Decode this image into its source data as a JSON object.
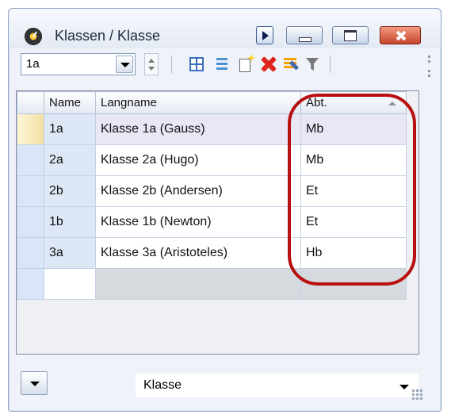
{
  "window": {
    "title": "Klassen / Klasse"
  },
  "toolbar": {
    "combo_value": "1a"
  },
  "grid": {
    "columns": [
      "Name",
      "Langname",
      "Abt."
    ],
    "rows": [
      {
        "name": "1a",
        "langname": "Klasse 1a (Gauss)",
        "abt": "Mb"
      },
      {
        "name": "2a",
        "langname": "Klasse 2a (Hugo)",
        "abt": "Mb"
      },
      {
        "name": "2b",
        "langname": "Klasse 2b (Andersen)",
        "abt": "Et"
      },
      {
        "name": "1b",
        "langname": "Klasse 1b (Newton)",
        "abt": "Et"
      },
      {
        "name": "3a",
        "langname": "Klasse 3a (Aristoteles)",
        "abt": "Hb"
      }
    ],
    "selected_row": "1a",
    "sorted_column": "Abt."
  },
  "bottom": {
    "view_select_value": "Klasse"
  },
  "colors": {
    "highlight": "#b80f10",
    "selection": "#e9e6f6"
  },
  "icons": [
    "app-clock-icon",
    "play-icon",
    "minimize-icon",
    "maximize-icon",
    "close-icon",
    "grid-detail-icon",
    "list-icon",
    "new-record-icon",
    "delete-icon",
    "edit-icon",
    "filter-icon"
  ]
}
